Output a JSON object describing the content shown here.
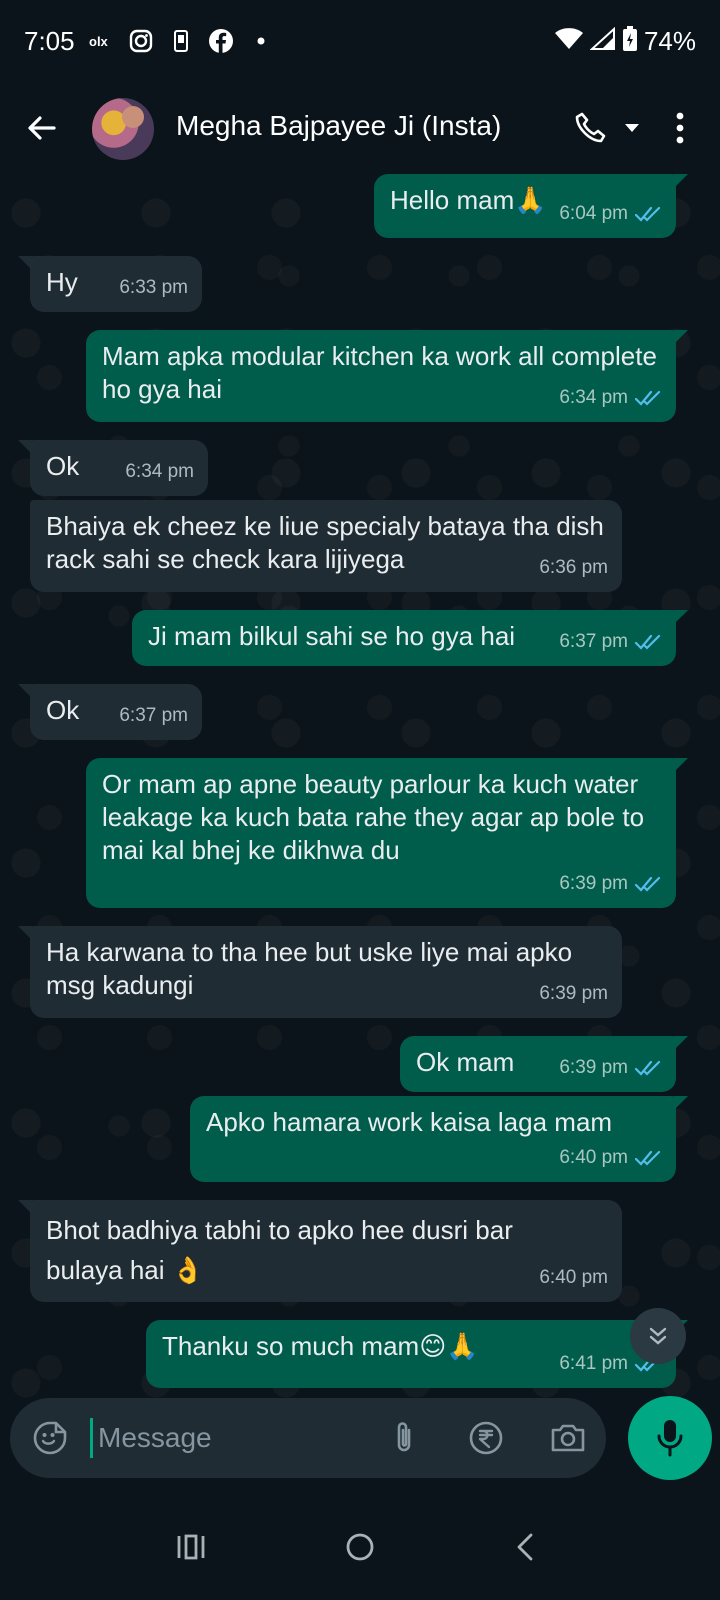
{
  "status_bar": {
    "time": "7:05",
    "battery": "74%",
    "left_icons": [
      "olx-icon",
      "instagram-icon",
      "phone-device-icon",
      "facebook-icon",
      "dot-icon"
    ],
    "right_icons": [
      "wifi-icon",
      "signal-icon",
      "battery-icon"
    ]
  },
  "header": {
    "contact_name": "Megha Bajpayee Ji (Insta)"
  },
  "messages": [
    {
      "dir": "out",
      "text": "Hello mam🙏",
      "time": "6:04 pm",
      "status": "read"
    },
    {
      "dir": "in",
      "text": "Hy",
      "time": "6:33 pm"
    },
    {
      "dir": "out",
      "text": "Mam apka modular kitchen ka work all complete ho gya hai",
      "time": "6:34 pm",
      "status": "read"
    },
    {
      "dir": "in",
      "text": "Ok",
      "time": "6:34 pm"
    },
    {
      "dir": "in",
      "text": "Bhaiya ek cheez ke liue specialy bataya tha dish rack sahi se check kara lijiyega",
      "time": "6:36 pm"
    },
    {
      "dir": "out",
      "text": "Ji mam bilkul sahi se ho gya hai",
      "time": "6:37 pm",
      "status": "read"
    },
    {
      "dir": "in",
      "text": "Ok",
      "time": "6:37 pm"
    },
    {
      "dir": "out",
      "text": "Or mam ap apne beauty parlour ka kuch water leakage ka kuch bata rahe they agar ap bole to mai kal bhej ke dikhwa du",
      "time": "6:39 pm",
      "status": "read"
    },
    {
      "dir": "in",
      "text": "Ha karwana to tha hee but uske liye mai apko msg kadungi",
      "time": "6:39 pm"
    },
    {
      "dir": "out",
      "text": "Ok mam",
      "time": "6:39 pm",
      "status": "read"
    },
    {
      "dir": "out",
      "text": "Apko hamara work kaisa laga mam",
      "time": "6:40 pm",
      "status": "read"
    },
    {
      "dir": "in",
      "text": "Bhot badhiya tabhi to apko hee dusri bar bulaya hai 👌",
      "time": "6:40 pm"
    },
    {
      "dir": "out",
      "text": "Thanku so much mam😊🙏",
      "time": "6:41 pm",
      "status": "read"
    }
  ],
  "input": {
    "placeholder": "Message",
    "value": ""
  },
  "colors": {
    "background": "#0b141a",
    "incoming_bubble": "#202c33",
    "outgoing_bubble": "#005c4b",
    "accent": "#00a884",
    "read_ticks": "#53bdeb"
  }
}
